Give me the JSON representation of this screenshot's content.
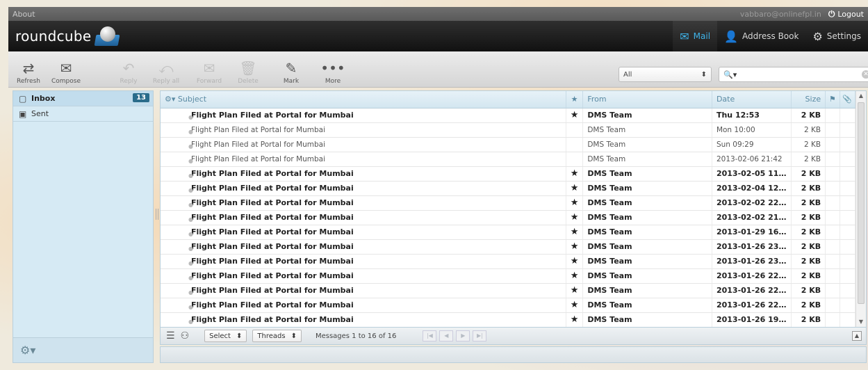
{
  "topline": {
    "about": "About",
    "user": "vabbaro@onlinefpl.in",
    "logout": "Logout"
  },
  "brand": {
    "name": "roundcube"
  },
  "taskbar": [
    {
      "label": "Mail",
      "icon": "mail-icon",
      "active": true
    },
    {
      "label": "Address Book",
      "icon": "person-icon",
      "active": false
    },
    {
      "label": "Settings",
      "icon": "gear-icon",
      "active": false
    }
  ],
  "toolbar": {
    "refresh": "Refresh",
    "compose": "Compose",
    "reply": "Reply",
    "reply_all": "Reply all",
    "forward": "Forward",
    "delete": "Delete",
    "mark": "Mark",
    "more": "More"
  },
  "filter": {
    "value": "All"
  },
  "search": {
    "placeholder": ""
  },
  "folders": [
    {
      "name": "Inbox",
      "count": "13",
      "selected": true
    },
    {
      "name": "Sent",
      "count": "",
      "selected": false
    }
  ],
  "list": {
    "headers": {
      "subject": "Subject",
      "from": "From",
      "date": "Date",
      "size": "Size"
    },
    "rows": [
      {
        "subject": "Flight Plan Filed at Portal for Mumbai",
        "from": "DMS Team",
        "date": "Thu 12:53",
        "size": "2 KB",
        "unread": true
      },
      {
        "subject": "Flight Plan Filed at Portal for Mumbai",
        "from": "DMS Team",
        "date": "Mon 10:00",
        "size": "2 KB",
        "unread": false
      },
      {
        "subject": "Flight Plan Filed at Portal for Mumbai",
        "from": "DMS Team",
        "date": "Sun 09:29",
        "size": "2 KB",
        "unread": false
      },
      {
        "subject": "Flight Plan Filed at Portal for Mumbai",
        "from": "DMS Team",
        "date": "2013-02-06 21:42",
        "size": "2 KB",
        "unread": false
      },
      {
        "subject": "Flight Plan Filed at Portal for Mumbai",
        "from": "DMS Team",
        "date": "2013-02-05 11...",
        "size": "2 KB",
        "unread": true
      },
      {
        "subject": "Flight Plan Filed at Portal for Mumbai",
        "from": "DMS Team",
        "date": "2013-02-04 12...",
        "size": "2 KB",
        "unread": true
      },
      {
        "subject": "Flight Plan Filed at Portal for Mumbai",
        "from": "DMS Team",
        "date": "2013-02-02 22...",
        "size": "2 KB",
        "unread": true
      },
      {
        "subject": "Flight Plan Filed at Portal for Mumbai",
        "from": "DMS Team",
        "date": "2013-02-02 21...",
        "size": "2 KB",
        "unread": true
      },
      {
        "subject": "Flight Plan Filed at Portal for Mumbai",
        "from": "DMS Team",
        "date": "2013-01-29 16...",
        "size": "2 KB",
        "unread": true
      },
      {
        "subject": "Flight Plan Filed at Portal for Mumbai",
        "from": "DMS Team",
        "date": "2013-01-26 23...",
        "size": "2 KB",
        "unread": true
      },
      {
        "subject": "Flight Plan Filed at Portal for Mumbai",
        "from": "DMS Team",
        "date": "2013-01-26 23...",
        "size": "2 KB",
        "unread": true
      },
      {
        "subject": "Flight Plan Filed at Portal for Mumbai",
        "from": "DMS Team",
        "date": "2013-01-26 22...",
        "size": "2 KB",
        "unread": true
      },
      {
        "subject": "Flight Plan Filed at Portal for Mumbai",
        "from": "DMS Team",
        "date": "2013-01-26 22...",
        "size": "2 KB",
        "unread": true
      },
      {
        "subject": "Flight Plan Filed at Portal for Mumbai",
        "from": "DMS Team",
        "date": "2013-01-26 22...",
        "size": "2 KB",
        "unread": true
      },
      {
        "subject": "Flight Plan Filed at Portal for Mumbai",
        "from": "DMS Team",
        "date": "2013-01-26 19...",
        "size": "2 KB",
        "unread": true
      }
    ]
  },
  "footer": {
    "select": "Select",
    "threads": "Threads",
    "count_text": "Messages 1 to 16 of 16"
  }
}
